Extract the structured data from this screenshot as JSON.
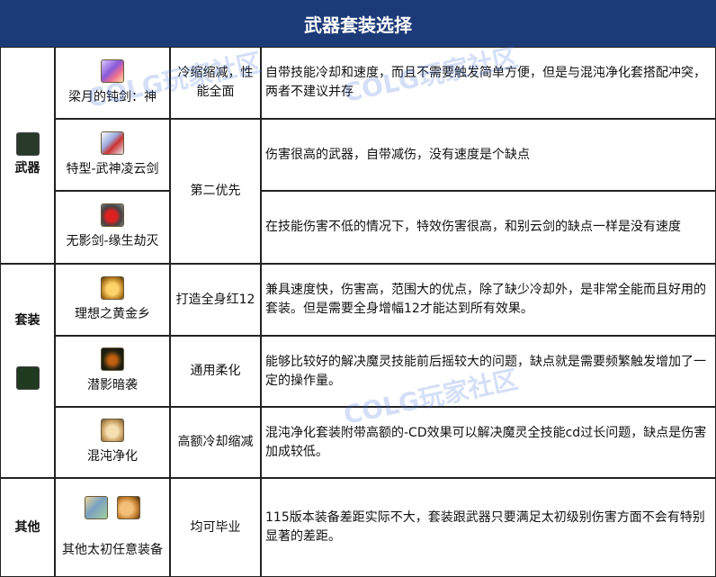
{
  "title": "武器套装选择",
  "watermark": "COLG玩家社区",
  "categories": {
    "weapon": "武器",
    "set": "套装",
    "other": "其他"
  },
  "rows": [
    {
      "item": "梁月的钝剑：神",
      "priority": "冷缩缩减，性能全面",
      "desc": "自带技能冷却和速度，而且不需要触发简单方便，但是与混沌净化套搭配冲突，两者不建议并存"
    },
    {
      "item": "特型-武神凌云剑",
      "desc": "伤害很高的武器，自带减伤，没有速度是个缺点"
    },
    {
      "item": "无影剑-缘生劫灭",
      "desc": "在技能伤害不低的情况下，特效伤害很高，和别云剑的缺点一样是没有速度"
    },
    {
      "item": "理想之黄金乡",
      "priority": "打造全身红12",
      "desc": "兼具速度快，伤害高，范围大的优点，除了缺少冷却外，是非常全能而且好用的套装。但是需要全身增幅12才能达到所有效果。"
    },
    {
      "item": "潜影暗袭",
      "priority": "通用柔化",
      "desc": "能够比较好的解决魔灵技能前后摇较大的问题，缺点就是需要频繁触发增加了一定的操作量。"
    },
    {
      "item": "混沌净化",
      "priority": "高额冷却缩减",
      "desc": "混沌净化套装附带高额的-CD效果可以解决魔灵全技能cd过长问题，缺点是伤害加成较低。"
    },
    {
      "item": "其他太初任意装备",
      "priority": "均可毕业",
      "desc": "115版本装备差距实际不大，套装跟武器只要满足太初级别伤害方面不会有特别显著的差距。"
    }
  ],
  "merged_priority": "第二优先",
  "colors": {
    "header_bg": "#1d3a78",
    "header_text": "#ffffff",
    "border": "#222222"
  },
  "icons": [
    "weapon-category-icon",
    "set-category-icon",
    "item-icon"
  ]
}
